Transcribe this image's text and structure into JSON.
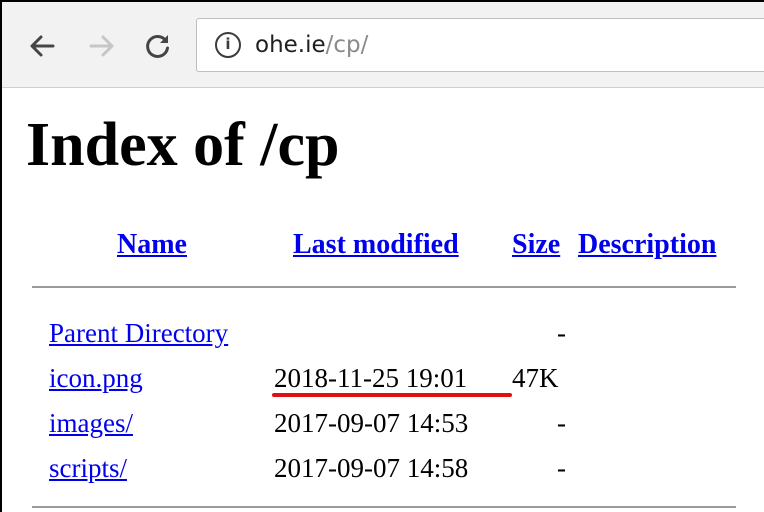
{
  "browser": {
    "url_host": "ohe.ie",
    "url_path": "/cp/",
    "info_glyph": "i",
    "icons": [
      "back-arrow-icon",
      "forward-arrow-icon",
      "reload-icon",
      "info-icon"
    ]
  },
  "page": {
    "title": "Index of /cp",
    "columns": {
      "name": "Name",
      "last_modified": "Last modified",
      "size": "Size",
      "description": "Description"
    },
    "rows": [
      {
        "name": "Parent Directory",
        "modified": "",
        "size": "-"
      },
      {
        "name": "icon.png",
        "modified": "2018-11-25 19:01",
        "size": "47K"
      },
      {
        "name": "images/",
        "modified": "2017-09-07 14:53",
        "size": "-"
      },
      {
        "name": "scripts/",
        "modified": "2017-09-07 14:58",
        "size": "-"
      }
    ]
  },
  "colors": {
    "link": "#0000ee",
    "annotation_underline": "#e01010",
    "toolbar_bg": "#f2f2f2"
  }
}
